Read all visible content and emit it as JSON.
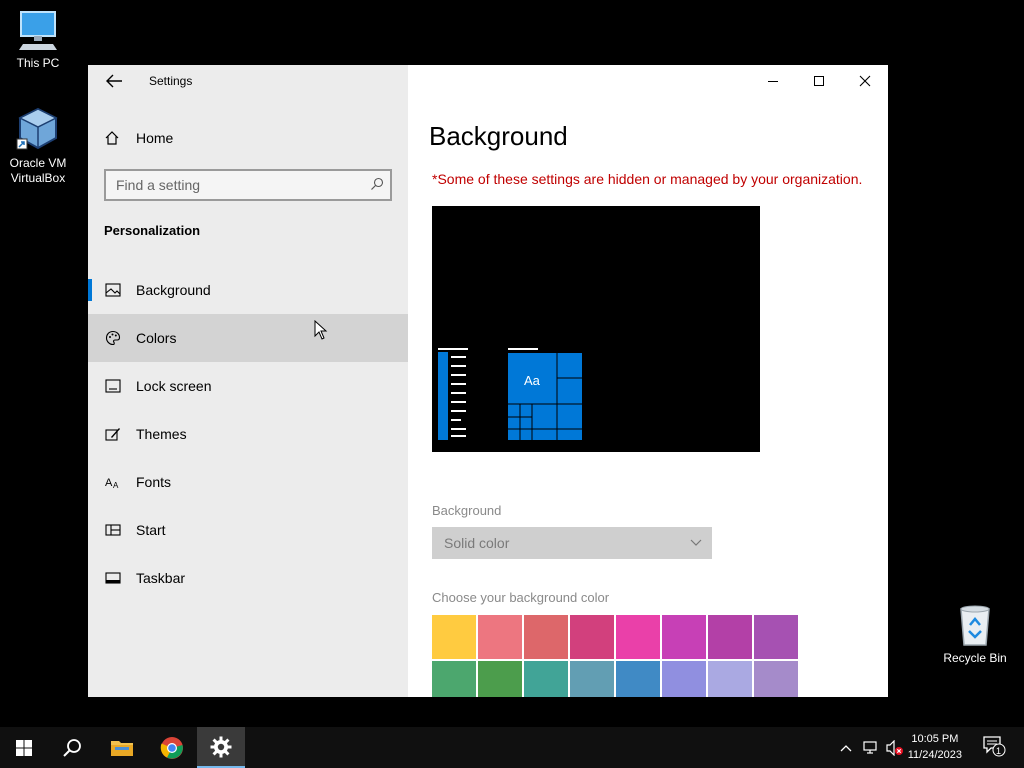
{
  "desktop": {
    "icons": [
      {
        "label": "This PC"
      },
      {
        "label": "Oracle VM VirtualBox"
      },
      {
        "label": "Recycle Bin"
      }
    ]
  },
  "window": {
    "title": "Settings",
    "sidebar": {
      "home_label": "Home",
      "search_placeholder": "Find a setting",
      "section_title": "Personalization",
      "items": [
        {
          "label": "Background",
          "icon": "picture-icon",
          "active": true
        },
        {
          "label": "Colors",
          "icon": "palette-icon",
          "hover": true
        },
        {
          "label": "Lock screen",
          "icon": "lock-screen-icon"
        },
        {
          "label": "Themes",
          "icon": "brush-icon"
        },
        {
          "label": "Fonts",
          "icon": "fonts-icon"
        },
        {
          "label": "Start",
          "icon": "start-icon"
        },
        {
          "label": "Taskbar",
          "icon": "taskbar-icon"
        }
      ]
    },
    "main": {
      "page_title": "Background",
      "warning": "*Some of these settings are hidden or managed by your organization.",
      "preview_tile_text": "Aa",
      "background_label": "Background",
      "background_value": "Solid color",
      "color_label": "Choose your background color",
      "accent_color": "#0078d7",
      "swatch_colors": [
        "#ffb900",
        "#e74856",
        "#d13438",
        "#c30052",
        "#e3008c",
        "#b4009e",
        "#9a0089",
        "#881798",
        "#10893e",
        "#107c10",
        "#018574",
        "#2d7d9a",
        "#0063b1",
        "#6b69d6",
        "#8e8cd8",
        "#8764b8"
      ]
    }
  },
  "taskbar": {
    "time": "10:05 PM",
    "date": "11/24/2023",
    "notification_count": "1"
  }
}
